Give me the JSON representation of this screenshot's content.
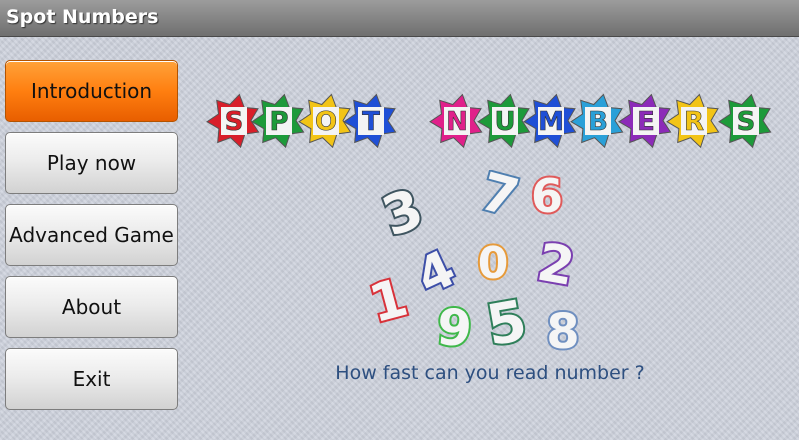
{
  "titlebar": {
    "title": "Spot Numbers"
  },
  "menu": {
    "items": [
      {
        "label": "Introduction",
        "active": true
      },
      {
        "label": "Play now",
        "active": false
      },
      {
        "label": "Advanced Game",
        "active": false
      },
      {
        "label": "About",
        "active": false
      },
      {
        "label": "Exit",
        "active": false
      }
    ]
  },
  "logo": {
    "letters": [
      "S",
      "P",
      "O",
      "T",
      "N",
      "U",
      "M",
      "B",
      "E",
      "R",
      "S"
    ],
    "letter_colors": [
      "#d81e2a",
      "#1d9a3a",
      "#f2c416",
      "#1f4fd6",
      "#e0208a",
      "#1d9a3a",
      "#1f4fd6",
      "#2aa0d8",
      "#8c2bb8",
      "#f2c416",
      "#1d9a3a"
    ]
  },
  "numbers_graphic": {
    "digits": [
      "3",
      "7",
      "6",
      "4",
      "0",
      "2",
      "1",
      "9",
      "5",
      "8"
    ],
    "digit_colors": [
      "#3f5560",
      "#4f7fb0",
      "#e05a5a",
      "#3d4fa8",
      "#e69a3a",
      "#7a3fb0",
      "#d8323a",
      "#3fb84a",
      "#2f7f5a",
      "#6f8fc0"
    ]
  },
  "tagline": "How fast can you read number ?",
  "colors": {
    "accent": "#ff7f10",
    "tagline": "#2d4f80"
  }
}
